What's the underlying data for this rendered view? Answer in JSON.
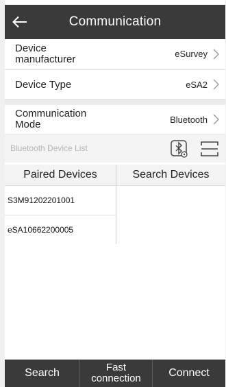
{
  "header": {
    "title": "Communication"
  },
  "rows": {
    "manufacturer": {
      "label": "Device manufacturer",
      "value": "eSurvey"
    },
    "device_type": {
      "label": "Device Type",
      "value": "eSA2"
    },
    "comm_mode": {
      "label": "Communication Mode",
      "value": "Bluetooth"
    }
  },
  "bluetooth": {
    "list_label": "Bluetooth Device List"
  },
  "tabs": {
    "paired": "Paired Devices",
    "search": "Search Devices"
  },
  "paired_devices": [
    "S3M91202201001",
    "eSA10662200005"
  ],
  "bottom_bar": {
    "search": "Search",
    "fast_connection": "Fast connection",
    "connect": "Connect"
  }
}
